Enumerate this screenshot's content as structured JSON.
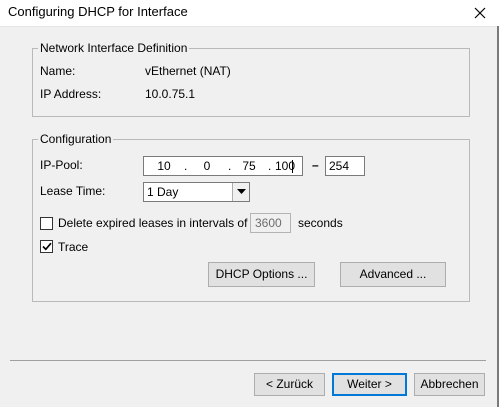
{
  "window": {
    "title": "Configuring DHCP for Interface",
    "close_icon": "close-icon"
  },
  "network_group": {
    "legend": "Network Interface Definition",
    "name_label": "Name:",
    "name_value": "vEthernet (NAT)",
    "ip_label": "IP Address:",
    "ip_value": "10.0.75.1"
  },
  "config_group": {
    "legend": "Configuration",
    "ip_pool_label": "IP-Pool:",
    "ip_pool": {
      "octets": [
        "10",
        "0",
        "75",
        "100"
      ],
      "separator": "–",
      "end": "254"
    },
    "lease_time_label": "Lease Time:",
    "lease_time_value": "1 Day",
    "delete_expired": {
      "label": "Delete expired leases in intervals of",
      "checked": false,
      "interval_value": "3600",
      "unit": "seconds"
    },
    "trace": {
      "label": "Trace",
      "checked": true
    },
    "dhcp_options_button": "DHCP Options ...",
    "advanced_button": "Advanced ..."
  },
  "footer": {
    "back_button": "< Zurück",
    "next_button": "Weiter >",
    "cancel_button": "Abbrechen"
  }
}
